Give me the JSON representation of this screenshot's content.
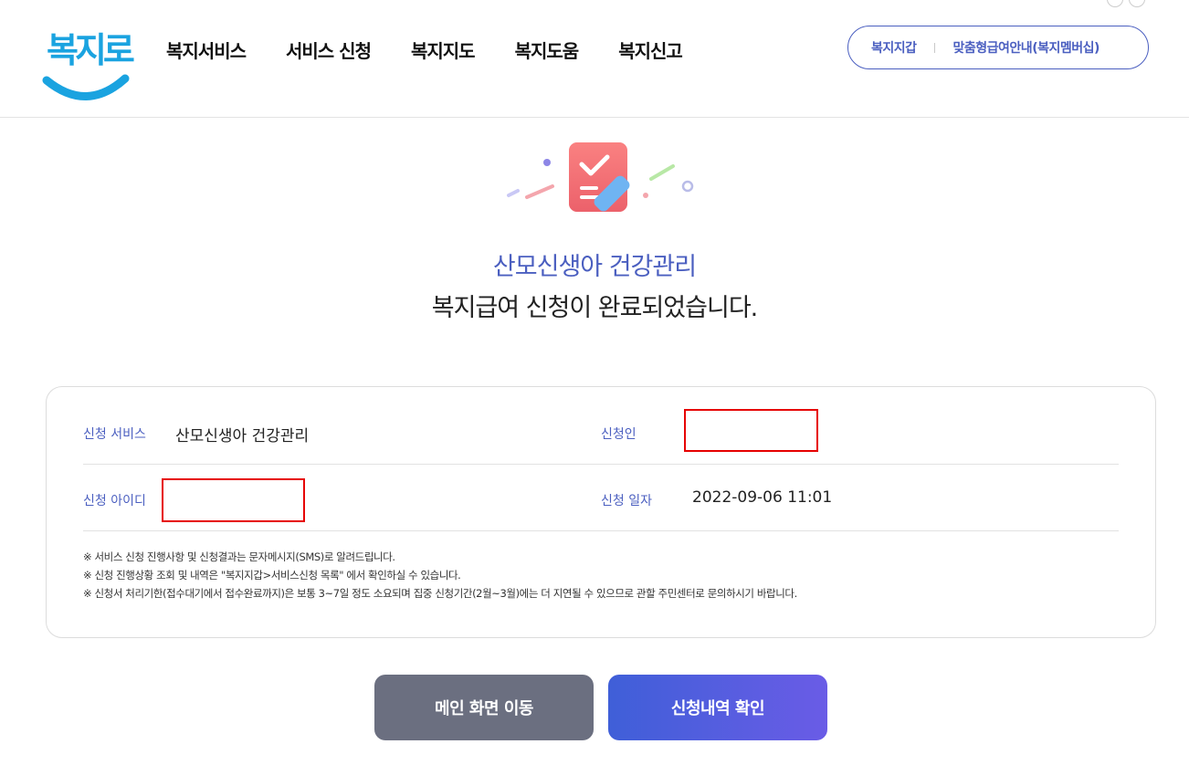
{
  "header": {
    "logo_text": "복지로",
    "nav": [
      "복지서비스",
      "서비스 신청",
      "복지지도",
      "복지도움",
      "복지신고"
    ],
    "util_links": [
      "복지지갑",
      "맞춤형급여안내(복지멤버십)"
    ]
  },
  "result": {
    "service_name": "산모신생아 건강관리",
    "message": "복지급여 신청이 완료되었습니다."
  },
  "info": {
    "service_label": "신청 서비스",
    "service_value": "산모신생아 건강관리",
    "applicant_label": "신청인",
    "applicant_value": "",
    "id_label": "신청 아이디",
    "id_value": "",
    "date_label": "신청 일자",
    "date_value": "2022-09-06 11:01",
    "notes": [
      "※ 서비스 신청 진행사항 및 신청결과는 문자메시지(SMS)로 알려드립니다.",
      "※ 신청 진행상황 조회 및 내역은 \"복지지갑>서비스신청 목록\" 에서 확인하실 수 있습니다.",
      "※ 신청서 처리기한(접수대기에서 접수완료까지)은 보통 3~7일 정도 소요되며 집중 신청기간(2월~3월)에는 더 지연될 수 있으므로 관할 주민센터로 문의하시기 바랍니다."
    ]
  },
  "buttons": {
    "main_label": "메인 화면 이동",
    "history_label": "신청내역 확인"
  },
  "colors": {
    "accent": "#4b5fc0",
    "logo": "#1aa3e0",
    "redaction": "#e60000",
    "button_gray": "#6b6f80"
  },
  "icons": [
    "checklist-pencil-icon"
  ]
}
